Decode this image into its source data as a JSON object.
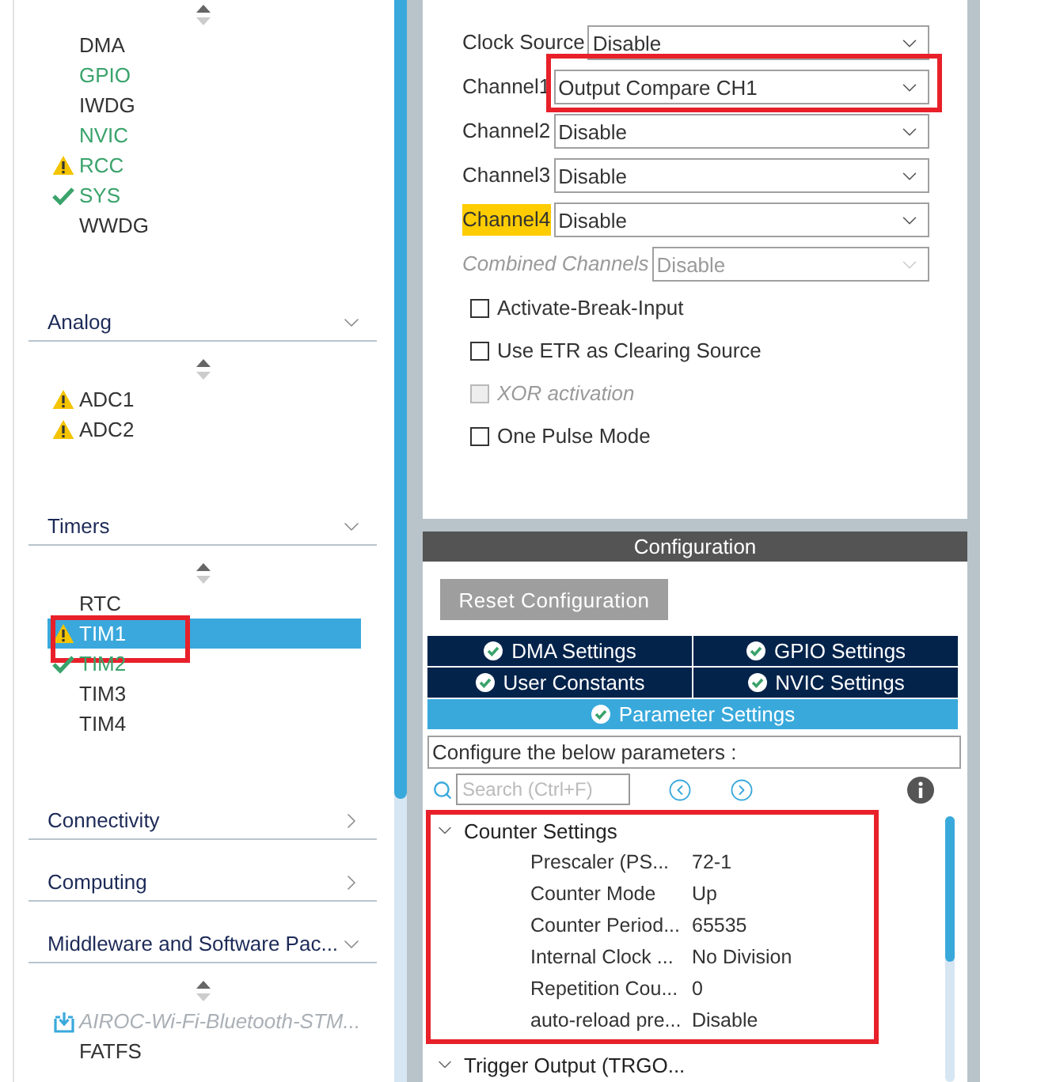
{
  "sidebar": {
    "sections": [
      {
        "items": [
          {
            "label": "DMA",
            "warning": false,
            "ok": false,
            "configured": false,
            "selected": false,
            "highlighted": false,
            "kind": "peripheral"
          },
          {
            "label": "GPIO",
            "warning": false,
            "ok": false,
            "configured": true,
            "selected": false,
            "highlighted": false,
            "kind": "peripheral"
          },
          {
            "label": "IWDG",
            "warning": false,
            "ok": false,
            "configured": false,
            "selected": false,
            "highlighted": false,
            "kind": "peripheral"
          },
          {
            "label": "NVIC",
            "warning": false,
            "ok": false,
            "configured": true,
            "selected": false,
            "highlighted": false,
            "kind": "peripheral"
          },
          {
            "label": "RCC",
            "warning": true,
            "ok": false,
            "configured": true,
            "selected": false,
            "highlighted": false,
            "kind": "peripheral"
          },
          {
            "label": "SYS",
            "warning": false,
            "ok": true,
            "configured": true,
            "selected": false,
            "highlighted": false,
            "kind": "peripheral"
          },
          {
            "label": "WWDG",
            "warning": false,
            "ok": false,
            "configured": false,
            "selected": false,
            "highlighted": false,
            "kind": "peripheral"
          }
        ]
      },
      {
        "title": "Analog",
        "expanded": true,
        "items": [
          {
            "label": "ADC1",
            "warning": true,
            "ok": false,
            "configured": false,
            "selected": false,
            "highlighted": false,
            "kind": "peripheral"
          },
          {
            "label": "ADC2",
            "warning": true,
            "ok": false,
            "configured": false,
            "selected": false,
            "highlighted": false,
            "kind": "peripheral"
          }
        ]
      },
      {
        "title": "Timers",
        "expanded": true,
        "items": [
          {
            "label": "RTC",
            "warning": false,
            "ok": false,
            "configured": false,
            "selected": false,
            "highlighted": false,
            "kind": "peripheral"
          },
          {
            "label": "TIM1",
            "warning": true,
            "ok": false,
            "selected": true,
            "highlighted": true,
            "kind": "peripheral"
          },
          {
            "label": "TIM2",
            "warning": false,
            "ok": true,
            "configured": true,
            "selected": false,
            "highlighted": false,
            "kind": "peripheral"
          },
          {
            "label": "TIM3",
            "warning": false,
            "ok": false,
            "configured": false,
            "selected": false,
            "highlighted": false,
            "kind": "peripheral"
          },
          {
            "label": "TIM4",
            "warning": false,
            "ok": false,
            "configured": false,
            "selected": false,
            "highlighted": false,
            "kind": "peripheral"
          }
        ]
      },
      {
        "title": "Connectivity",
        "expanded": false
      },
      {
        "title": "Computing",
        "expanded": false
      },
      {
        "title": "Middleware and Software Pac...",
        "expanded": true,
        "items": [
          {
            "label": "AIROC-Wi-Fi-Bluetooth-STM...",
            "selected": false,
            "highlighted": false,
            "kind": "package"
          },
          {
            "label": "FATFS",
            "warning": false,
            "ok": false,
            "configured": false,
            "selected": false,
            "highlighted": false,
            "kind": "peripheral"
          }
        ]
      }
    ]
  },
  "mode": {
    "fields": [
      {
        "label": "Clock Source",
        "value": "Disable",
        "disabled": false,
        "flagged": false,
        "highlighted": false
      },
      {
        "label": "Channel1",
        "value": "Output Compare CH1",
        "disabled": false,
        "flagged": false,
        "highlighted": true
      },
      {
        "label": "Channel2",
        "value": "Disable",
        "disabled": false,
        "flagged": false,
        "highlighted": false
      },
      {
        "label": "Channel3",
        "value": "Disable",
        "disabled": false,
        "flagged": false,
        "highlighted": false
      },
      {
        "label": "Channel4",
        "value": "Disable",
        "disabled": false,
        "flagged": true,
        "highlighted": false
      },
      {
        "label": "Combined Channels",
        "value": "Disable",
        "disabled": true,
        "flagged": false,
        "highlighted": false
      }
    ],
    "checkboxes": [
      {
        "label": "Activate-Break-Input",
        "checked": false,
        "disabled": false
      },
      {
        "label": "Use ETR as Clearing Source",
        "checked": false,
        "disabled": false
      },
      {
        "label": "XOR activation",
        "checked": false,
        "disabled": true
      },
      {
        "label": "One Pulse Mode",
        "checked": false,
        "disabled": false
      }
    ]
  },
  "configuration": {
    "title": "Configuration",
    "reset_button": "Reset Configuration",
    "tab_rows": [
      [
        {
          "label": "DMA Settings",
          "selected": false
        },
        {
          "label": "GPIO Settings",
          "selected": false
        }
      ],
      [
        {
          "label": "User Constants",
          "selected": false
        },
        {
          "label": "NVIC Settings",
          "selected": false
        }
      ],
      [
        {
          "label": "Parameter Settings",
          "selected": true
        }
      ]
    ],
    "hint": "Configure the below parameters :",
    "search": {
      "placeholder": "Search (Ctrl+F)"
    },
    "groups": [
      {
        "title": "Counter Settings",
        "expanded": true,
        "highlighted": true,
        "params": [
          {
            "name": "Prescaler (PS...",
            "value": "72-1"
          },
          {
            "name": "Counter Mode",
            "value": "Up"
          },
          {
            "name": "Counter Period...",
            "value": "65535"
          },
          {
            "name": "Internal Clock ...",
            "value": "No Division"
          },
          {
            "name": "Repetition Cou...",
            "value": "0"
          },
          {
            "name": "auto-reload pre...",
            "value": "Disable"
          }
        ]
      },
      {
        "title": "Trigger Output (TRGO...",
        "expanded": true,
        "highlighted": false
      }
    ]
  }
}
